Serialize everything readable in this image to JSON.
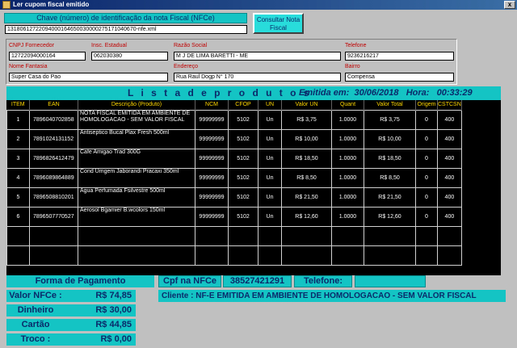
{
  "window": {
    "title": "Ler cupom fiscal emitido",
    "close_glyph": "x"
  },
  "key_section": {
    "label": "Chave (número) de identificação da nota Fiscal (NFCe)",
    "value": "13180612722094000164650030000275171040670-nfe.xml",
    "consult_button": "Consultar Nota Fiscal"
  },
  "fields": {
    "cnpj_label": "CNPJ Fornecedor",
    "cnpj_value": "12722094000164",
    "ie_label": "Insc. Estadual",
    "ie_value": "062030380",
    "razao_label": "Razão Social",
    "razao_value": "M J DE LIMA BARETTI - ME",
    "tel_label": "Telefone",
    "tel_value": "9236216217",
    "fantasia_label": "Nome Fantasia",
    "fantasia_value": "Super Casa do Pao",
    "endereco_label": "Endereço",
    "endereco_value": "Rua Raul Dogp N° 170",
    "bairro_label": "Bairro",
    "bairro_value": "Compensa"
  },
  "products_bar": {
    "title": "L i s t a   d e   p r o d u t o s",
    "emitted_label": "Emitida em:",
    "emitted_date": "30/06/2018",
    "hour_label": "Hora:",
    "emitted_time": "00:33:29"
  },
  "table": {
    "headers": [
      "ITEM",
      "EAN",
      "Descrição (Produto)",
      "NCM",
      "CFOP",
      "UN",
      "Valor UN",
      "Quant",
      "Valor Total",
      "Origem",
      "CSTCSN"
    ],
    "rows": [
      [
        "1",
        "7896040702858",
        "NOTA FISCAL EMITIDA EM AMBIENTE DE HOMOLOGACAO - SEM VALOR FISCAL",
        "99999999",
        "5102",
        "Un",
        "R$ 3,75",
        "1.0000",
        "R$ 3,75",
        "0",
        "400"
      ],
      [
        "2",
        "7891024131152",
        "Antiseptico Bucal Plax Fresh 500ml",
        "99999999",
        "5102",
        "Un",
        "R$ 10,00",
        "1.0000",
        "R$ 10,00",
        "0",
        "400"
      ],
      [
        "3",
        "7896826412479",
        "Cafe Amigao Trad 300G",
        "99999999",
        "5102",
        "Un",
        "R$ 18,50",
        "1.0000",
        "R$ 18,50",
        "0",
        "400"
      ],
      [
        "4",
        "7896089864889",
        "Cond Umgem Jaborandi Pracaxi 350ml",
        "99999999",
        "5102",
        "Un",
        "R$ 8,50",
        "1.0000",
        "R$ 8,50",
        "0",
        "400"
      ],
      [
        "5",
        "7896508810201",
        "Agua Perfumada Fsilvestre 500ml",
        "99999999",
        "5102",
        "Un",
        "R$ 21,50",
        "1.0000",
        "R$ 21,50",
        "0",
        "400"
      ],
      [
        "6",
        "7896507770527",
        "Aerosol Bgamier B.wcolors 150ml",
        "99999999",
        "5102",
        "Un",
        "R$ 12,60",
        "1.0000",
        "R$ 12,60",
        "0",
        "400"
      ]
    ]
  },
  "payment": {
    "title": "Forma de Pagamento",
    "items": [
      {
        "label": "Valor NFCe :",
        "value": "R$ 74,85"
      },
      {
        "label": "Dinheiro",
        "value": "R$ 30,00"
      },
      {
        "label": "Cartão",
        "value": "R$ 44,85"
      },
      {
        "label": "Troco :",
        "value": "R$ 0,00"
      }
    ]
  },
  "consumer": {
    "cpf_label": "Cpf na NFCe",
    "cpf_value": "38527421291",
    "phone_label": "Telefone:",
    "phone_value": "",
    "client_line": "Cliente : NF-E EMITIDA EM AMBIENTE DE HOMOLOGACAO - SEM VALOR FISCAL"
  },
  "colors": {
    "accent": "#14c4c4",
    "accent_text": "#0a2a6a",
    "grid_bg": "#000000",
    "grid_header": "#ffd800",
    "label_red": "#c00000"
  }
}
